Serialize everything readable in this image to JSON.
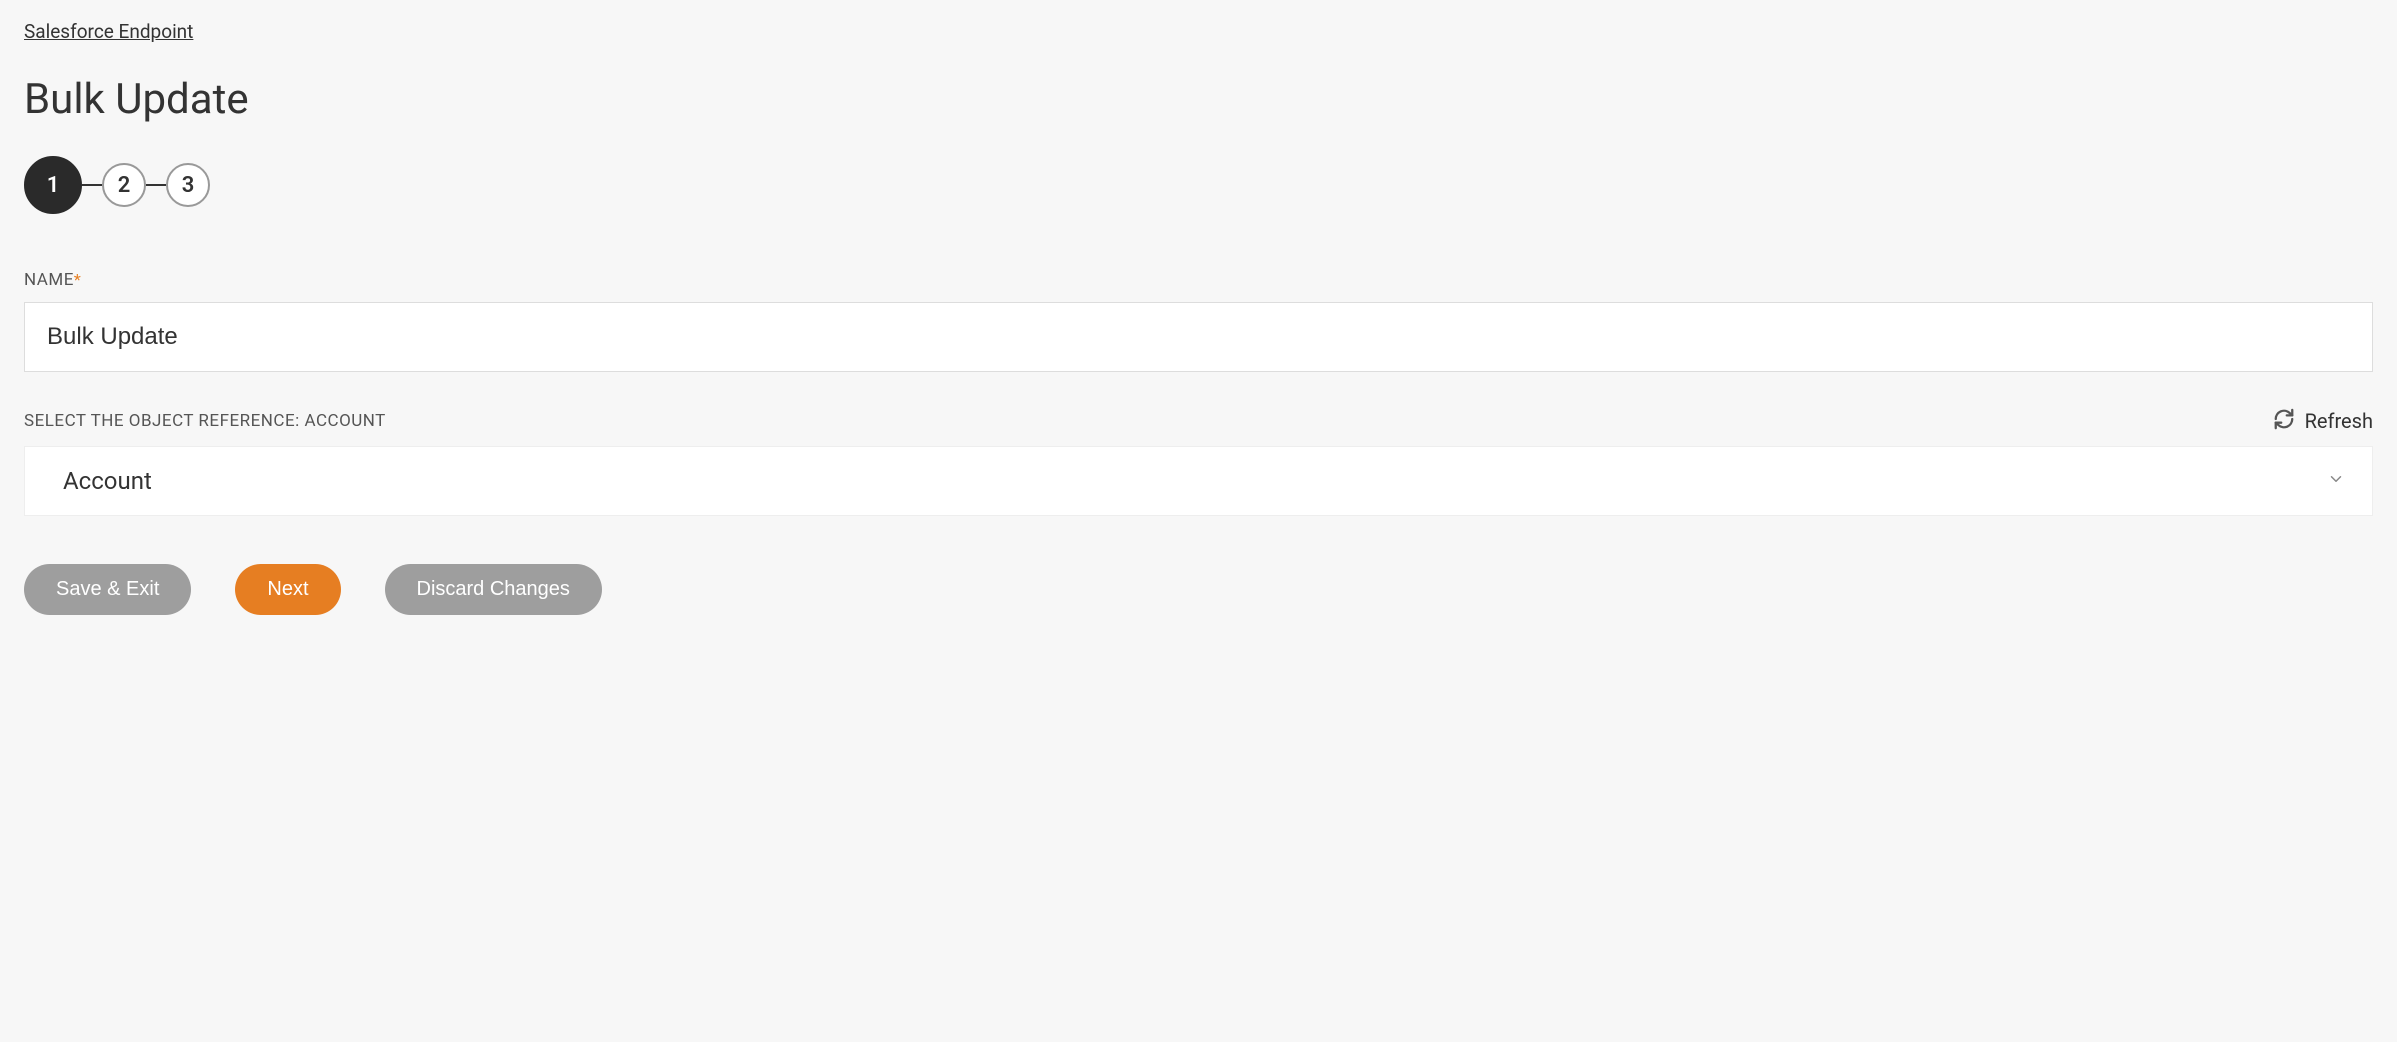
{
  "breadcrumb": {
    "label": "Salesforce Endpoint"
  },
  "page": {
    "title": "Bulk Update"
  },
  "stepper": {
    "steps": [
      "1",
      "2",
      "3"
    ],
    "active_index": 0
  },
  "form": {
    "name": {
      "label": "NAME",
      "required": true,
      "value": "Bulk Update"
    },
    "object_reference": {
      "label": "SELECT THE OBJECT REFERENCE: ACCOUNT",
      "refresh_label": "Refresh",
      "selected": "Account"
    }
  },
  "buttons": {
    "save_exit": "Save & Exit",
    "next": "Next",
    "discard": "Discard Changes"
  }
}
